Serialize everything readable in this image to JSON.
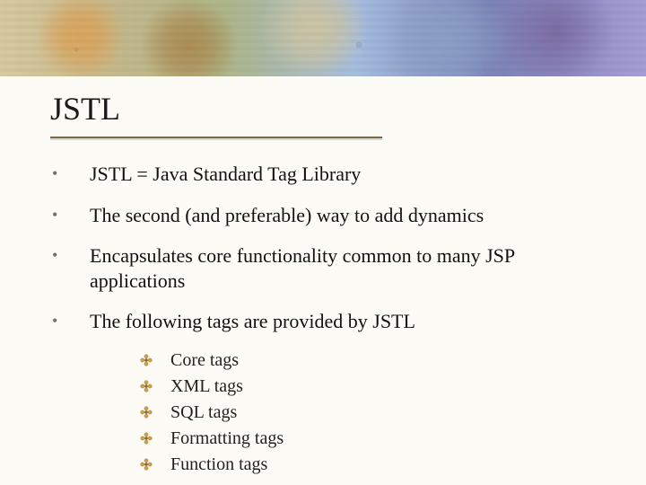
{
  "title": "JSTL",
  "bullets": [
    {
      "text": "JSTL = Java Standard Tag Library"
    },
    {
      "text": "The second (and preferable) way to add dynamics"
    },
    {
      "text": "Encapsulates core functionality common to many JSP applications"
    },
    {
      "text": "The following tags are provided by JSTL",
      "sub": [
        "Core tags",
        "XML tags",
        "SQL tags",
        "Formatting tags",
        "Function tags"
      ]
    }
  ],
  "colors": {
    "accent": "#cfa14a",
    "accent_dark": "#8a6a2a"
  }
}
